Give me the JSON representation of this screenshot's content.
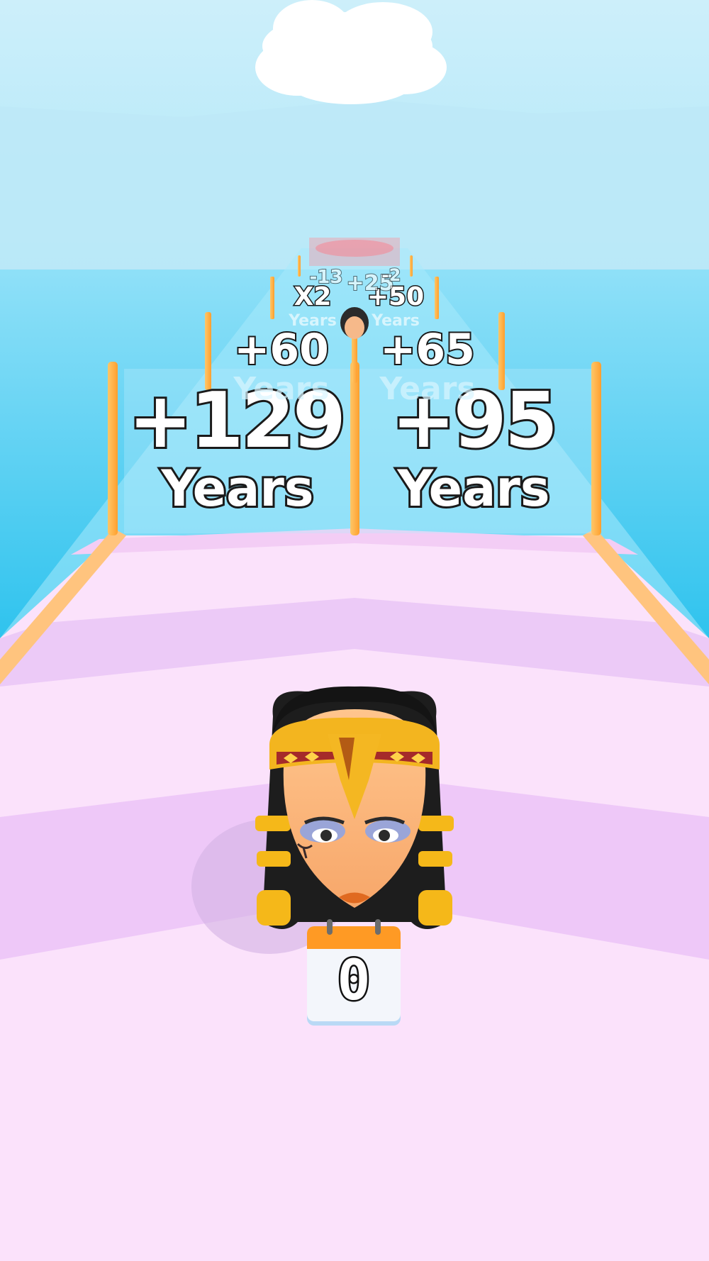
{
  "gates": {
    "row1": [
      {
        "value": "+129",
        "unit": "Years"
      },
      {
        "value": "+95",
        "unit": "Years"
      }
    ],
    "row2": [
      {
        "value": "+60",
        "unit": "Years"
      },
      {
        "value": "+65",
        "unit": "Years"
      }
    ],
    "row3": [
      {
        "value": "X2",
        "unit": "Years"
      },
      {
        "value": "+50",
        "unit": "Years"
      }
    ],
    "row4": [
      {
        "value": "-13"
      },
      {
        "value": "+25"
      },
      {
        "value": "-2"
      }
    ]
  },
  "player": {
    "character": "cleopatra-head",
    "age_counter": "0"
  },
  "colors": {
    "sky": "#cdeffa",
    "water": "#33c6ef",
    "track": "#fbe2fb",
    "track_stripe": "#eec8f8",
    "post": "#ffb44a"
  }
}
